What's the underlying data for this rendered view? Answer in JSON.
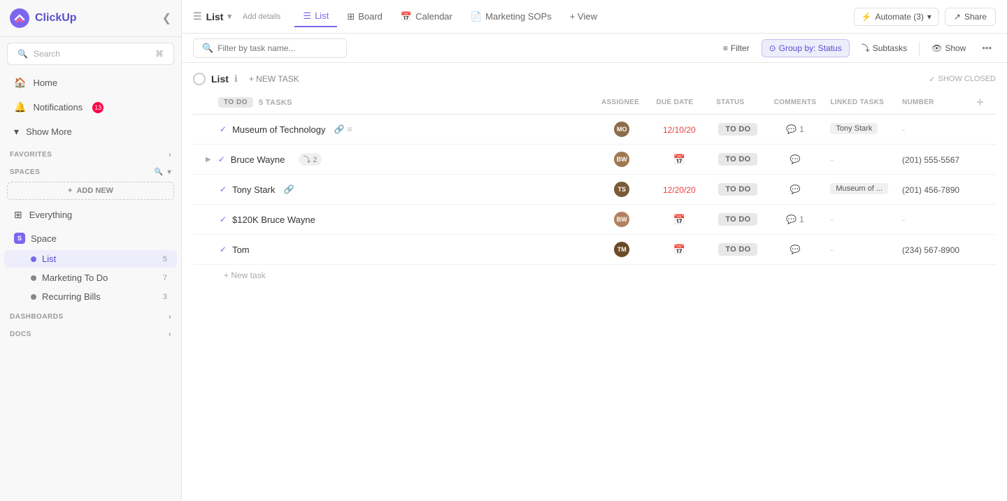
{
  "sidebar": {
    "logo": "ClickUp",
    "collapse_icon": "❮",
    "search_placeholder": "Search",
    "home_label": "Home",
    "notifications_label": "Notifications",
    "notifications_badge": "13",
    "show_more_label": "Show More",
    "favorites_label": "FAVORITES",
    "spaces_label": "SPACES",
    "add_new_label": "ADD NEW",
    "everything_label": "Everything",
    "space_label": "Space",
    "space_initial": "S",
    "list_label": "List",
    "list_count": "5",
    "marketing_to_do_label": "Marketing To Do",
    "marketing_to_do_count": "7",
    "recurring_bills_label": "Recurring Bills",
    "recurring_bills_count": "3",
    "dashboards_label": "DASHBOARDS",
    "docs_label": "DOCS"
  },
  "top_nav": {
    "list_title": "List",
    "add_details": "Add details",
    "tabs": [
      {
        "id": "list",
        "label": "List",
        "icon": "☰",
        "active": true
      },
      {
        "id": "board",
        "label": "Board",
        "icon": "⊞"
      },
      {
        "id": "calendar",
        "label": "Calendar",
        "icon": "📅"
      },
      {
        "id": "marketing_sops",
        "label": "Marketing SOPs",
        "icon": "📄"
      },
      {
        "id": "view",
        "label": "+ View",
        "icon": ""
      }
    ],
    "automate_label": "Automate",
    "automate_count": "3",
    "share_label": "Share"
  },
  "toolbar": {
    "filter_placeholder": "Filter by task name...",
    "filter_label": "Filter",
    "group_by_label": "Group by: Status",
    "subtasks_label": "Subtasks",
    "show_label": "Show"
  },
  "list_view": {
    "title": "List",
    "new_task_label": "+ NEW TASK",
    "show_closed_label": "SHOW CLOSED",
    "group_label": "TO DO",
    "group_count": "5 TASKS",
    "columns": {
      "assignee": "ASSIGNEE",
      "due_date": "DUE DATE",
      "status": "STATUS",
      "comments": "COMMENTS",
      "linked_tasks": "LINKED TASKS",
      "number": "NUMBER"
    },
    "tasks": [
      {
        "id": 1,
        "name": "Museum of Technology",
        "has_link": true,
        "has_list": true,
        "has_subtasks": false,
        "subtask_count": null,
        "assignee_color": "#8b6b4a",
        "assignee_initials": "MO",
        "due_date": "12/10/20",
        "due_date_red": true,
        "status": "TO DO",
        "comments": 1,
        "linked": "Tony Stark",
        "number": "-",
        "has_expand": false
      },
      {
        "id": 2,
        "name": "Bruce Wayne",
        "has_link": false,
        "has_list": false,
        "has_subtasks": true,
        "subtask_count": 2,
        "assignee_color": "#a07850",
        "assignee_initials": "BW",
        "due_date": "",
        "due_date_red": false,
        "status": "TO DO",
        "comments": 0,
        "linked": "-",
        "number": "(201) 555-5567",
        "has_expand": true
      },
      {
        "id": 3,
        "name": "Tony Stark",
        "has_link": true,
        "has_list": false,
        "has_subtasks": false,
        "subtask_count": null,
        "assignee_color": "#7a5a38",
        "assignee_initials": "TS",
        "due_date": "12/20/20",
        "due_date_red": true,
        "status": "TO DO",
        "comments": 0,
        "linked": "Museum of ...",
        "number": "(201) 456-7890",
        "has_expand": false
      },
      {
        "id": 4,
        "name": "$120K Bruce Wayne",
        "has_link": false,
        "has_list": false,
        "has_subtasks": false,
        "subtask_count": null,
        "assignee_color": "#b08060",
        "assignee_initials": "BW",
        "due_date": "",
        "due_date_red": false,
        "status": "TO DO",
        "comments": 1,
        "linked": "-",
        "number": "-",
        "has_expand": false
      },
      {
        "id": 5,
        "name": "Tom",
        "has_link": false,
        "has_list": false,
        "has_subtasks": false,
        "subtask_count": null,
        "assignee_color": "#6a4a28",
        "assignee_initials": "TM",
        "due_date": "",
        "due_date_red": false,
        "status": "TO DO",
        "comments": 0,
        "linked": "-",
        "number": "(234) 567-8900",
        "has_expand": false
      }
    ],
    "add_task_label": "+ New task"
  }
}
